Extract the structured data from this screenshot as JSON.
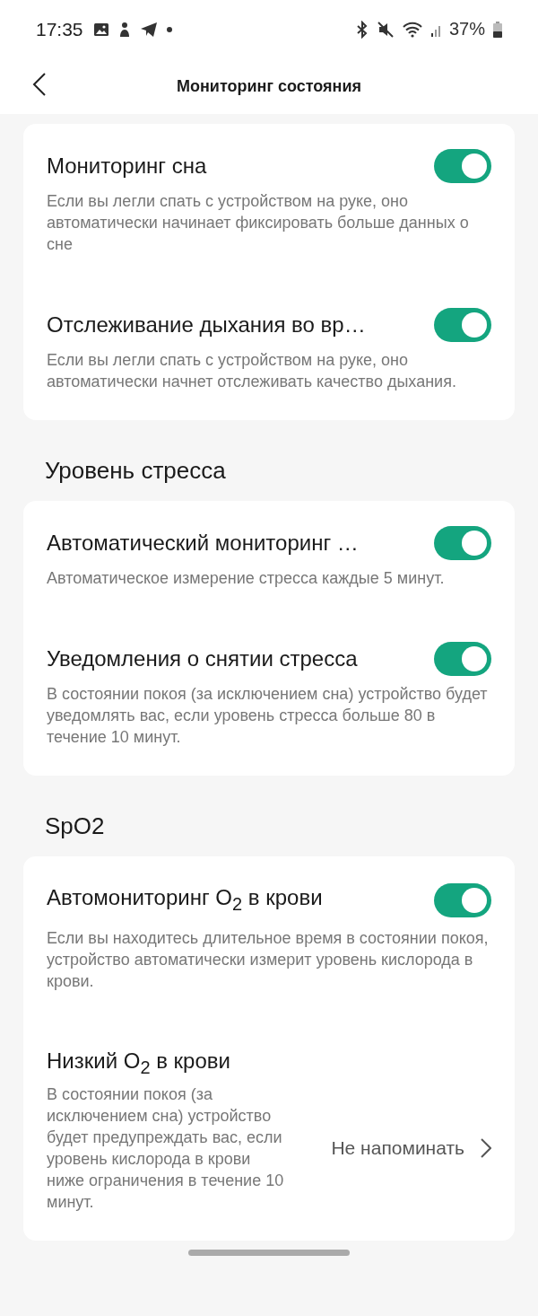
{
  "status_bar": {
    "time": "17:35",
    "battery": "37%"
  },
  "header": {
    "title": "Мониторинг состояния"
  },
  "sections": [
    {
      "items": [
        {
          "kind": "toggle",
          "title": "Мониторинг сна",
          "description": "Если вы легли спать с устройством на руке, оно автоматически начинает фиксировать больше данных о сне",
          "on": true
        },
        {
          "kind": "toggle",
          "title": "Отслеживание дыхания во вр…",
          "description": "Если вы легли спать с устройством на руке, оно автоматически начнет отслеживать качество дыхания.",
          "on": true
        }
      ]
    },
    {
      "heading": "Уровень стресса",
      "items": [
        {
          "kind": "toggle",
          "title": "Автоматический мониторинг …",
          "description": "Автоматическое измерение стресса каждые 5 минут.",
          "on": true
        },
        {
          "kind": "toggle",
          "title": "Уведомления о снятии стресса",
          "description": "В состоянии покоя (за исключением сна) устройство будет уведомлять вас, если уровень стресса больше 80 в течение 10 минут.",
          "on": true
        }
      ]
    },
    {
      "heading": "SpO2",
      "items": [
        {
          "kind": "toggle",
          "title": "Автомониторинг O$_{2}$ в крови",
          "description": "Если вы находитесь длительное время в состоянии покоя, устройство автоматически измерит уровень кислорода в крови.",
          "on": true
        },
        {
          "kind": "value",
          "title": "Низкий O$_{2}$ в крови",
          "description": "В состоянии покоя (за исключением сна) устройство будет предупреждать вас, если уровень кислорода в крови ниже ограничения в течение 10 минут.",
          "value": "Не напоминать"
        }
      ]
    }
  ]
}
